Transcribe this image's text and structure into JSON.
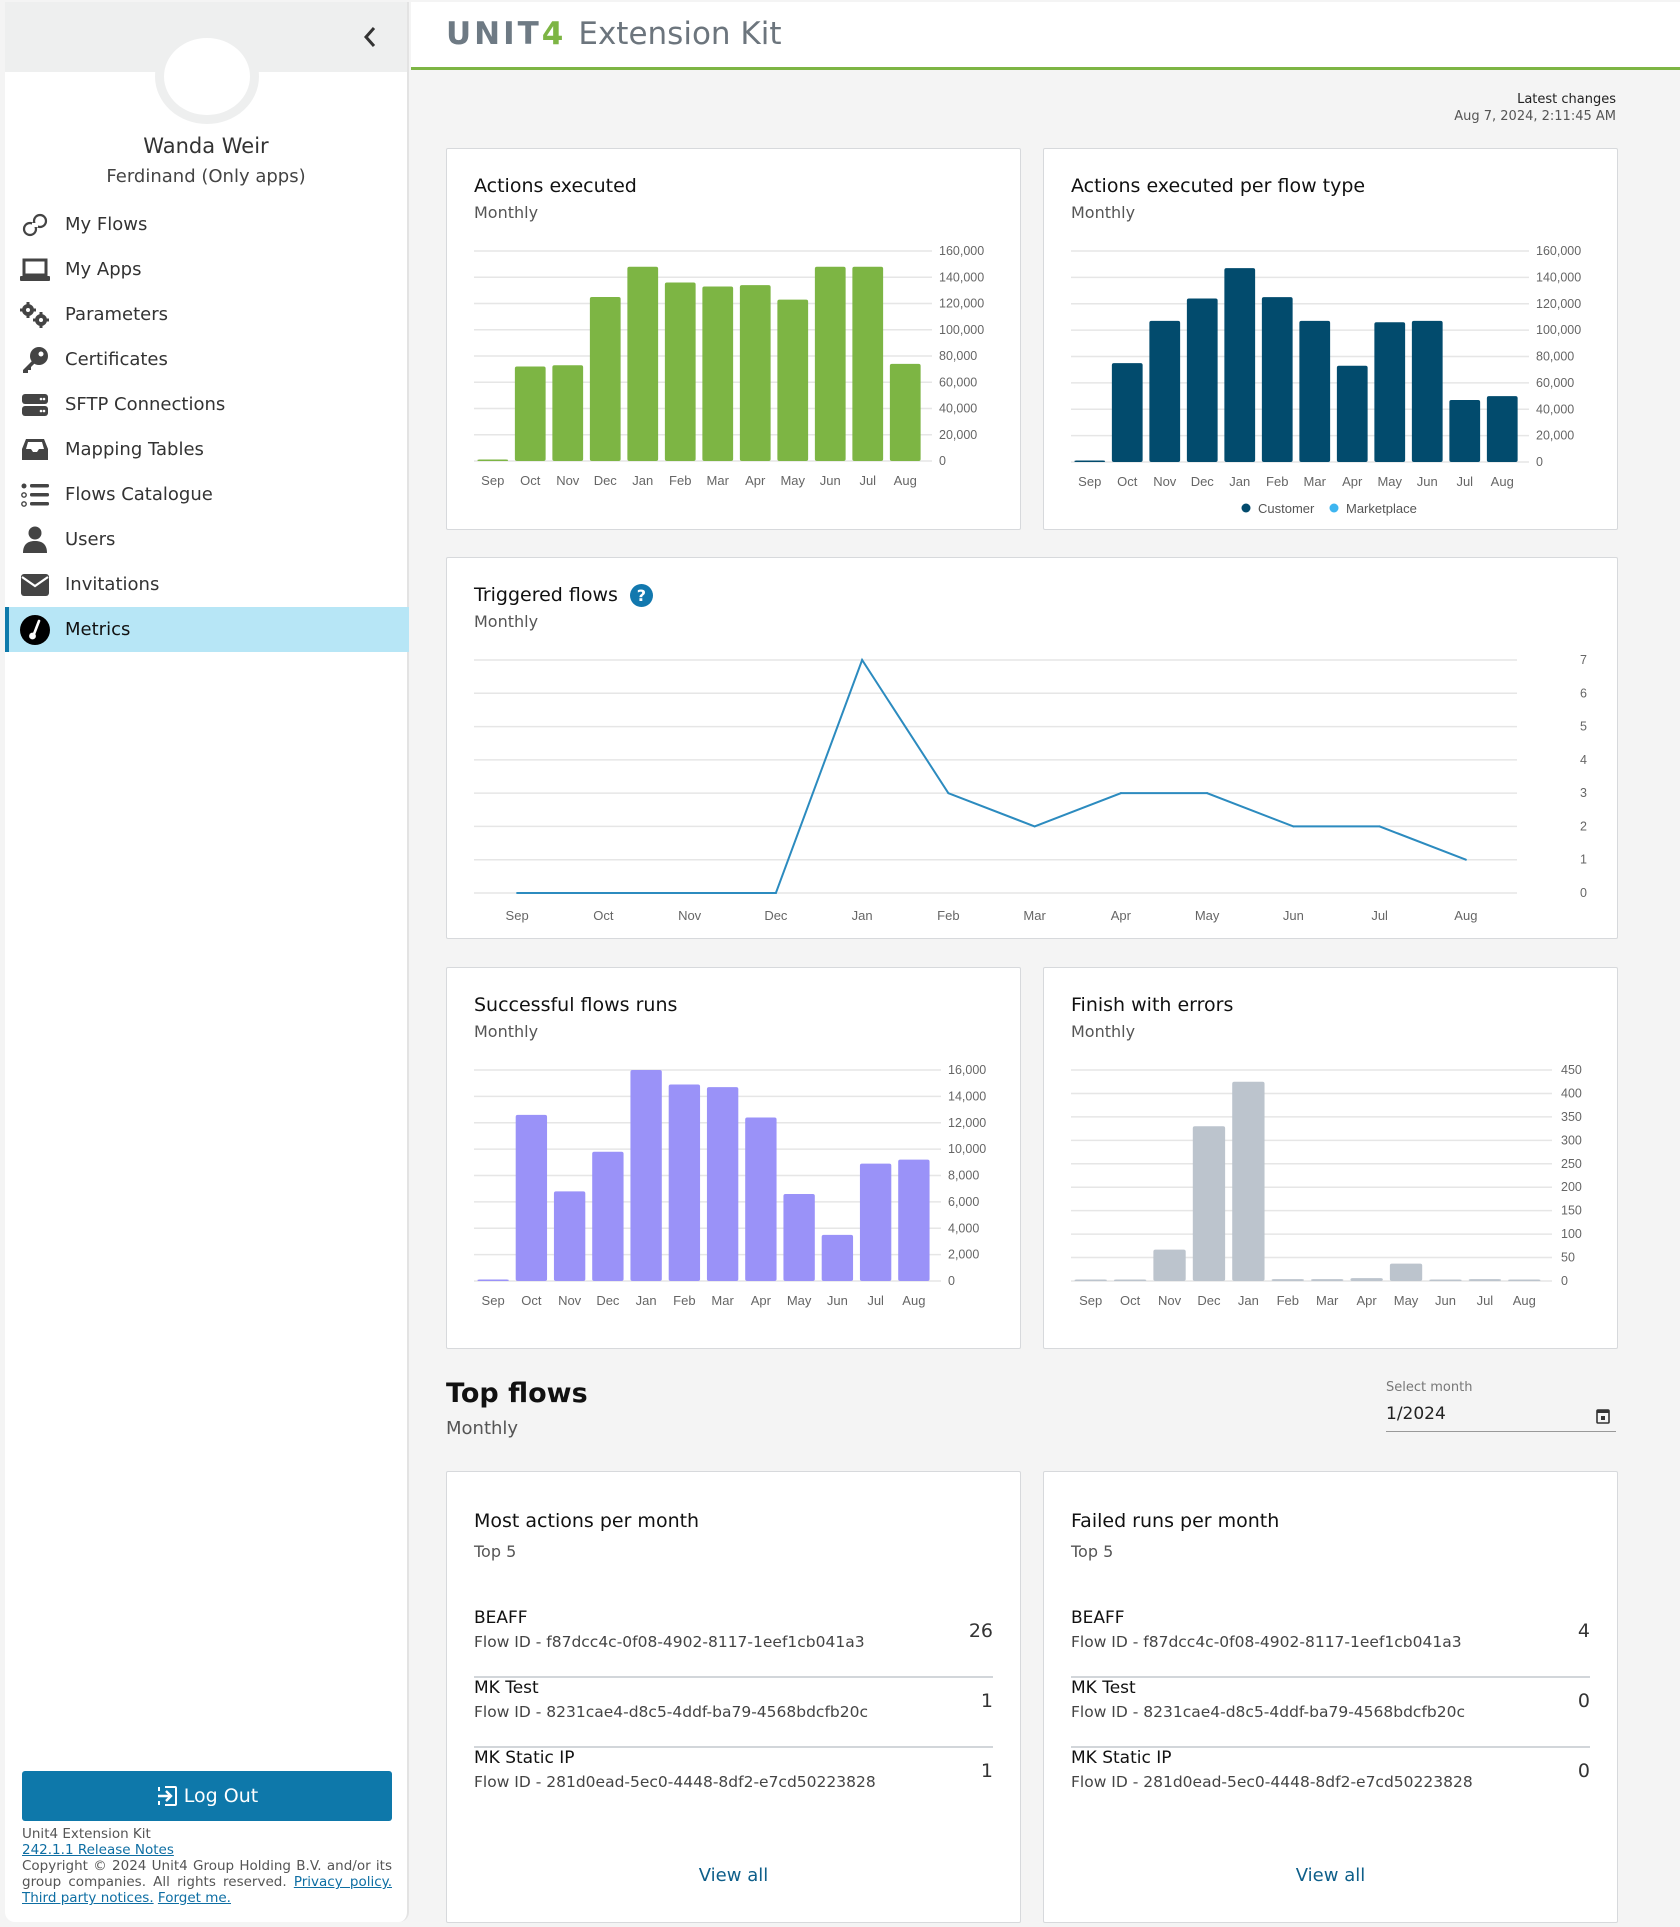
{
  "app": {
    "brand_unit": "UNIT",
    "brand_four": "4",
    "brand_name": "Extension Kit"
  },
  "user": {
    "name": "Wanda Weir",
    "org": "Ferdinand (Only apps)"
  },
  "nav": {
    "items": [
      {
        "label": "My Flows",
        "icon": "link-icon"
      },
      {
        "label": "My Apps",
        "icon": "laptop-icon"
      },
      {
        "label": "Parameters",
        "icon": "gears-icon"
      },
      {
        "label": "Certificates",
        "icon": "key-icon"
      },
      {
        "label": "SFTP Connections",
        "icon": "server-icon"
      },
      {
        "label": "Mapping Tables",
        "icon": "inbox-icon"
      },
      {
        "label": "Flows Catalogue",
        "icon": "list-icon"
      },
      {
        "label": "Users",
        "icon": "user-icon"
      },
      {
        "label": "Invitations",
        "icon": "envelope-icon"
      },
      {
        "label": "Metrics",
        "icon": "gauge-icon",
        "active": true
      }
    ],
    "active_color": "#b7e6f6"
  },
  "sidebar_footer": {
    "logout_label": "Log Out",
    "product": "Unit4 Extension Kit",
    "release_link": "242.1.1 Release Notes",
    "copyright": "Copyright © 2024 Unit4 Group Holding B.V. and/or its group companies. All rights reserved.",
    "privacy_link": "Privacy policy.",
    "third_party_link": "Third party notices.",
    "forget_link": "Forget me."
  },
  "latest_changes": {
    "label": "Latest changes",
    "value": "Aug 7, 2024, 2:11:45 AM"
  },
  "colors": {
    "accent_green": "#7db544",
    "primary_blue": "#0e78aa",
    "customer": "#024b6d",
    "marketplace": "#3eb5f0",
    "successful": "#9a92f8",
    "errors": "#bcc4cd",
    "line": "#2c8bbf"
  },
  "chart_data": [
    {
      "id": "actions_executed",
      "type": "bar",
      "title": "Actions executed",
      "subtitle": "Monthly",
      "categories": [
        "Sep",
        "Oct",
        "Nov",
        "Dec",
        "Jan",
        "Feb",
        "Mar",
        "Apr",
        "May",
        "Jun",
        "Jul",
        "Aug"
      ],
      "values": [
        0,
        72000,
        73000,
        125000,
        148000,
        136000,
        133000,
        134000,
        123000,
        148000,
        148000,
        74000
      ],
      "ylim": [
        0,
        160000
      ],
      "yticks": [
        "0",
        "20,000",
        "40,000",
        "60,000",
        "80,000",
        "100,000",
        "120,000",
        "140,000",
        "160,000"
      ],
      "grid": true
    },
    {
      "id": "actions_per_flow_type",
      "type": "bar",
      "title": "Actions executed per flow type",
      "subtitle": "Monthly",
      "categories": [
        "Sep",
        "Oct",
        "Nov",
        "Dec",
        "Jan",
        "Feb",
        "Mar",
        "Apr",
        "May",
        "Jun",
        "Jul",
        "Aug"
      ],
      "series": [
        {
          "name": "Customer",
          "values": [
            0,
            75000,
            107000,
            124000,
            147000,
            125000,
            107000,
            73000,
            106000,
            107000,
            47000,
            50000
          ]
        },
        {
          "name": "Marketplace",
          "values": [
            0,
            0,
            0,
            0,
            0,
            0,
            0,
            0,
            0,
            0,
            0,
            0
          ]
        }
      ],
      "ylim": [
        0,
        160000
      ],
      "yticks": [
        "0",
        "20,000",
        "40,000",
        "60,000",
        "80,000",
        "100,000",
        "120,000",
        "140,000",
        "160,000"
      ],
      "legend": "bottom",
      "grid": true
    },
    {
      "id": "triggered_flows",
      "type": "line",
      "title": "Triggered flows",
      "subtitle": "Monthly",
      "categories": [
        "Sep",
        "Oct",
        "Nov",
        "Dec",
        "Jan",
        "Feb",
        "Mar",
        "Apr",
        "May",
        "Jun",
        "Jul",
        "Aug"
      ],
      "values": [
        0,
        0,
        0,
        0,
        7,
        3,
        2,
        3,
        3,
        2,
        2,
        1
      ],
      "ylim": [
        0,
        7
      ],
      "yticks": [
        "0",
        "1",
        "2",
        "3",
        "4",
        "5",
        "6",
        "7"
      ],
      "grid": true
    },
    {
      "id": "successful_runs",
      "type": "bar",
      "title": "Successful flows runs",
      "subtitle": "Monthly",
      "categories": [
        "Sep",
        "Oct",
        "Nov",
        "Dec",
        "Jan",
        "Feb",
        "Mar",
        "Apr",
        "May",
        "Jun",
        "Jul",
        "Aug"
      ],
      "values": [
        0,
        12600,
        6800,
        9800,
        16000,
        14900,
        14700,
        12400,
        6600,
        3500,
        8900,
        9200
      ],
      "ylim": [
        0,
        16000
      ],
      "yticks": [
        "0",
        "2,000",
        "4,000",
        "6,000",
        "8,000",
        "10,000",
        "12,000",
        "14,000",
        "16,000"
      ],
      "grid": true
    },
    {
      "id": "finish_with_errors",
      "type": "bar",
      "title": "Finish with errors",
      "subtitle": "Monthly",
      "categories": [
        "Sep",
        "Oct",
        "Nov",
        "Dec",
        "Jan",
        "Feb",
        "Mar",
        "Apr",
        "May",
        "Jun",
        "Jul",
        "Aug"
      ],
      "values": [
        0,
        0,
        67,
        330,
        425,
        4,
        4,
        6,
        37,
        1,
        4,
        0
      ],
      "ylim": [
        0,
        450
      ],
      "yticks": [
        "0",
        "50",
        "100",
        "150",
        "200",
        "250",
        "300",
        "350",
        "400",
        "450"
      ],
      "grid": true
    }
  ],
  "top_flows": {
    "title": "Top flows",
    "subtitle": "Monthly",
    "month_label": "Select month",
    "month_value": "1/2024",
    "most_actions": {
      "title": "Most actions per month",
      "subtitle": "Top 5",
      "rows": [
        {
          "name": "BEAFF",
          "id": "Flow ID - f87dcc4c-0f08-4902-8117-1eef1cb041a3",
          "value": "26"
        },
        {
          "name": "MK Test",
          "id": "Flow ID - 8231cae4-d8c5-4ddf-ba79-4568bdcfb20c",
          "value": "1"
        },
        {
          "name": "MK Static IP",
          "id": "Flow ID - 281d0ead-5ec0-4448-8df2-e7cd50223828",
          "value": "1"
        }
      ],
      "view_all": "View all"
    },
    "failed_runs": {
      "title": "Failed runs per month",
      "subtitle": "Top 5",
      "rows": [
        {
          "name": "BEAFF",
          "id": "Flow ID - f87dcc4c-0f08-4902-8117-1eef1cb041a3",
          "value": "4"
        },
        {
          "name": "MK Test",
          "id": "Flow ID - 8231cae4-d8c5-4ddf-ba79-4568bdcfb20c",
          "value": "0"
        },
        {
          "name": "MK Static IP",
          "id": "Flow ID - 281d0ead-5ec0-4448-8df2-e7cd50223828",
          "value": "0"
        }
      ],
      "view_all": "View all"
    }
  }
}
